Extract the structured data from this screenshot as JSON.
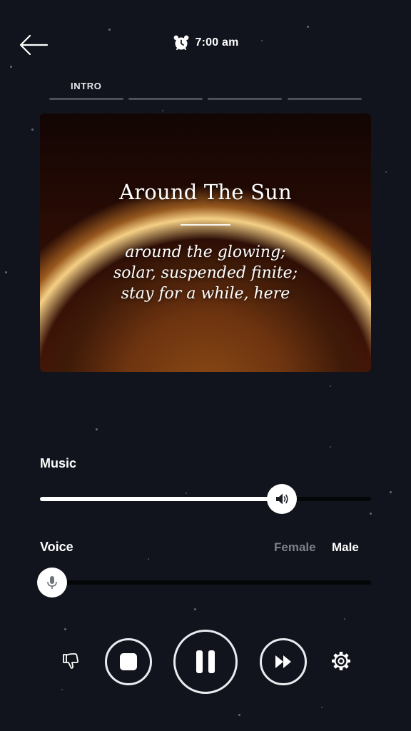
{
  "header": {
    "back_icon": "arrow-left-icon",
    "alarm_icon": "alarm-clock-icon",
    "alarm_time": "7:00 am"
  },
  "progress": {
    "label": "INTRO",
    "segments": 4
  },
  "card": {
    "title": "Around The Sun",
    "poem_lines": [
      "around the glowing;",
      "solar, suspended finite;",
      "stay for a while, here"
    ]
  },
  "music": {
    "label": "Music",
    "level": 0.73,
    "icon": "speaker-icon"
  },
  "voice": {
    "label": "Voice",
    "level": 0.0,
    "icon": "microphone-icon",
    "options": [
      "Female",
      "Male"
    ],
    "selected": "Male"
  },
  "controls": {
    "dislike_icon": "thumbs-down-icon",
    "stop_icon": "stop-icon",
    "pause_icon": "pause-icon",
    "skip_icon": "fast-forward-icon",
    "settings_icon": "gear-icon"
  },
  "colors": {
    "background": "#11141c",
    "track": "#050608",
    "accent": "#ffffff",
    "inactive_text": "#7c808a"
  }
}
